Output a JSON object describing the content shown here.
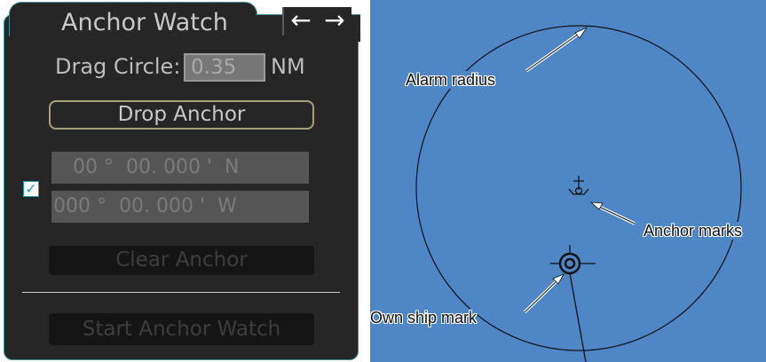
{
  "dialog": {
    "title": "Anchor Watch",
    "nav_back_icon": "←",
    "nav_forward_icon": "→",
    "drag_circle_label": "Drag Circle:",
    "drag_circle_value": "0.35",
    "drag_circle_unit": "NM",
    "drop_anchor_label": "Drop Anchor",
    "latitude": "00 °  00. 000 '  N",
    "longitude": "000 °  00. 000 '  W",
    "position_checked": true,
    "checkbox_glyph": "✓",
    "clear_anchor_label": "Clear Anchor",
    "start_watch_label": "Start Anchor Watch"
  },
  "radar": {
    "background_color": "#4f86c6",
    "callouts": {
      "alarm_radius": "Alarm radius",
      "anchor_mark": "Anchor marks",
      "own_ship_mark": "Own ship mark"
    }
  }
}
